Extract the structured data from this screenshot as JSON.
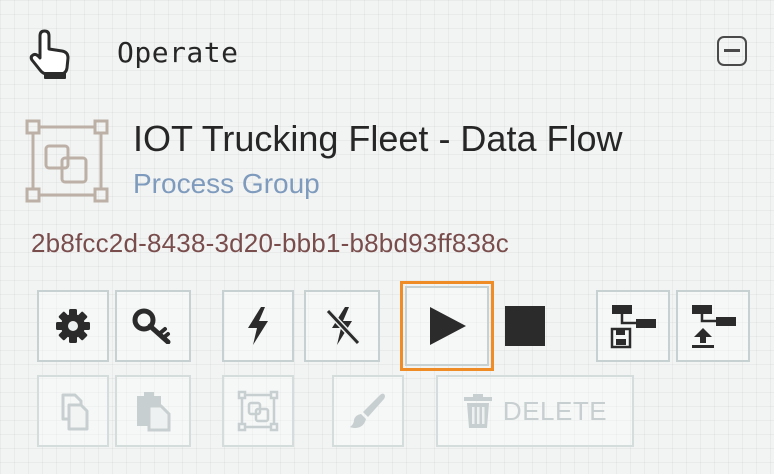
{
  "header": {
    "title": "Operate",
    "icon": "hand-pointer-icon",
    "collapse_icon": "minus-square-icon"
  },
  "component": {
    "name": "IOT Trucking Fleet - Data Flow",
    "type": "Process Group",
    "id": "2b8fcc2d-8438-3d20-bbb1-b8bd93ff838c",
    "icon": "process-group-icon"
  },
  "toolbar": {
    "row1": [
      {
        "icon": "gear-icon",
        "enabled": true
      },
      {
        "icon": "key-icon",
        "enabled": true
      },
      {
        "icon": "lightning-icon",
        "enabled": true
      },
      {
        "icon": "lightning-off-icon",
        "enabled": true
      },
      {
        "icon": "play-icon",
        "enabled": true,
        "highlighted": true
      },
      {
        "icon": "stop-icon",
        "enabled": true
      },
      {
        "icon": "save-template-icon",
        "enabled": true
      },
      {
        "icon": "upload-template-icon",
        "enabled": true
      }
    ],
    "row2": [
      {
        "icon": "copy-icon",
        "enabled": false
      },
      {
        "icon": "paste-icon",
        "enabled": false
      },
      {
        "icon": "group-icon",
        "enabled": false
      },
      {
        "icon": "paintbrush-icon",
        "enabled": false
      },
      {
        "icon": "trash-icon",
        "enabled": false
      }
    ],
    "delete_label": "DELETE"
  },
  "colors": {
    "accent_highlight": "#f08c26",
    "component_type": "#7e9bbd",
    "component_id": "#7a4d4d",
    "button_border": "#c7d1d1",
    "disabled_icon": "#c8cfd0"
  }
}
